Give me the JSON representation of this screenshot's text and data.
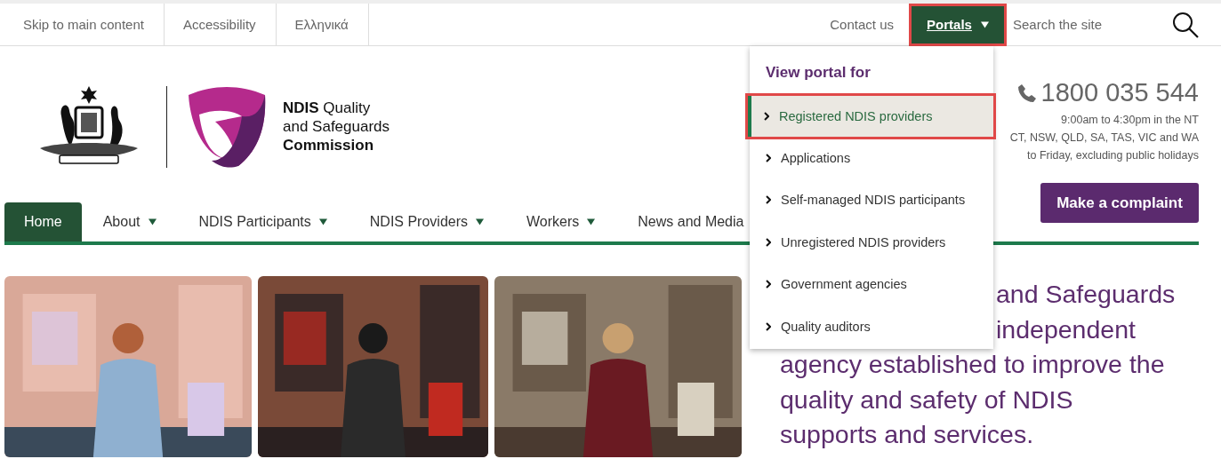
{
  "top_bar": {
    "links": [
      {
        "label": "Skip to main content"
      },
      {
        "label": "Accessibility"
      },
      {
        "label": "Ελληνικά"
      }
    ],
    "contact": "Contact us",
    "portals": {
      "label": "Portals",
      "expanded": true
    },
    "search": {
      "placeholder": "Search the site"
    }
  },
  "logo": {
    "lines": [
      {
        "text": "**NDIS** Quality",
        "bold": false
      },
      {
        "text": "and Safeguards",
        "bold": false
      },
      {
        "text": "Commission",
        "bold": true
      }
    ]
  },
  "phone": {
    "number": "1800 035 544",
    "hours": [
      "9:00am to 4:30pm in the NT",
      "CT, NSW, QLD, SA, TAS, VIC and WA",
      "to Friday, excluding public holidays"
    ]
  },
  "complaint_button": "Make a complaint",
  "nav": [
    {
      "label": "Home",
      "selected": true,
      "menu": false
    },
    {
      "label": "About",
      "selected": false,
      "menu": true
    },
    {
      "label": "NDIS Participants",
      "selected": false,
      "menu": true
    },
    {
      "label": "NDIS Providers",
      "selected": false,
      "menu": true
    },
    {
      "label": "Workers",
      "selected": false,
      "menu": true
    },
    {
      "label": "News and Media",
      "selected": false,
      "menu": false
    }
  ],
  "hero": {
    "lines": [
      "and Safeguards",
      "independent",
      "agency established to improve the",
      "quality and safety of NDIS",
      "supports and services."
    ]
  },
  "portal_menu": {
    "heading": "View portal for",
    "items": [
      {
        "label": "Registered NDIS providers",
        "selected": true
      },
      {
        "label": "Applications",
        "selected": false
      },
      {
        "label": "Self-managed NDIS participants",
        "selected": false
      },
      {
        "label": "Unregistered NDIS providers",
        "selected": false
      },
      {
        "label": "Government agencies",
        "selected": false
      },
      {
        "label": "Quality auditors",
        "selected": false
      }
    ]
  }
}
